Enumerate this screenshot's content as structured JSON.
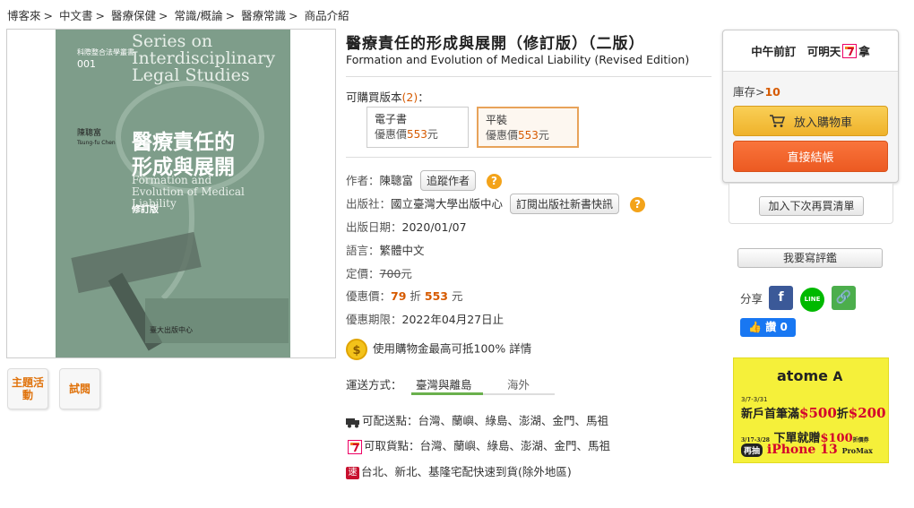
{
  "breadcrumb": [
    "博客來",
    "中文書",
    "醫療保健",
    "常識/概論",
    "醫療常識",
    "商品介紹"
  ],
  "cover": {
    "series_tag": "科際整合法學叢書",
    "series_num": "001",
    "series_en": "Series on Interdisciplinary Legal Studies",
    "author": "陳聰富",
    "author_en": "Tsung-fu Chen",
    "title_zh_line1": "醫療責任的",
    "title_zh_line2": "形成與展開",
    "title_en": "Formation and Evolution of Medical Liability",
    "edition": "修訂版",
    "publisher": "臺大出版中心"
  },
  "tiles": {
    "theme": "主題活動",
    "preview": "試閱"
  },
  "product": {
    "title_zh": "醫療責任的形成與展開（修訂版）（二版）",
    "title_en": "Formation and Evolution of Medical Liability (Revised Edition)",
    "available_label": "可購買版本",
    "available_count": "(2)",
    "available_suffix": "：",
    "versions": [
      {
        "name": "電子書",
        "price_label": "優惠價",
        "price": "553",
        "unit": "元"
      },
      {
        "name": "平裝",
        "price_label": "優惠價",
        "price": "553",
        "unit": "元"
      }
    ],
    "author_label": "作者：",
    "author": "陳聰富",
    "follow_author": "追蹤作者",
    "publisher_label": "出版社：",
    "publisher": "國立臺灣大學出版中心",
    "subscribe_publisher": "訂閱出版社新書快訊",
    "date_label": "出版日期：",
    "date": "2020/01/07",
    "lang_label": "語言：",
    "lang": "繁體中文",
    "list_price_label": "定價：",
    "list_price": "700",
    "list_price_unit": "元",
    "sale_label": "優惠價：",
    "discount": "79",
    "discount_suffix": "折",
    "sale_price": "553",
    "sale_unit": "元",
    "period_label": "優惠期限：",
    "period": "2022年04月27日止",
    "credit_text_1": "使用購物金最高可抵",
    "credit_pct": "100%",
    "credit_detail": "詳情",
    "shipping_label": "運送方式：",
    "ship_tabs": [
      "臺灣與離島",
      "海外"
    ],
    "ship_lines": [
      {
        "label": "可配送點",
        "text": "：台灣、蘭嶼、綠島、澎湖、金門、馬祖"
      },
      {
        "label": "可取貨點",
        "text": "：台灣、蘭嶼、綠島、澎湖、金門、馬祖"
      },
      {
        "label": "",
        "text": "台北、新北、基隆宅配快速到貨(除外地區)"
      }
    ]
  },
  "buy": {
    "head_text_1": "中午前訂　可明天",
    "head_text_2": "拿",
    "stock_label": "庫存>",
    "stock": "10",
    "cart": "放入購物車",
    "checkout": "直接結帳",
    "wishlist": "加入下次再買清單",
    "review": "我要寫評鑑",
    "share_label": "分享",
    "like": "讚 0"
  },
  "ad": {
    "brand": "atome",
    "date1": "3/7-3/31",
    "line1a": "新戶首筆滿",
    "line1b": "$500",
    "line1c": "折",
    "line1d": "$200",
    "date2": "3/17-3/28",
    "line2a": "下單就贈",
    "line2b": "$100",
    "line2c": "折價券",
    "tag": "再抽",
    "line3a": "iPhone 13",
    "line3b": "ProMax"
  },
  "colors": {
    "accent": "#d65a00",
    "cart": "#efb22b",
    "checkout": "#ec5a22",
    "tab_active": "#6ab04c"
  }
}
